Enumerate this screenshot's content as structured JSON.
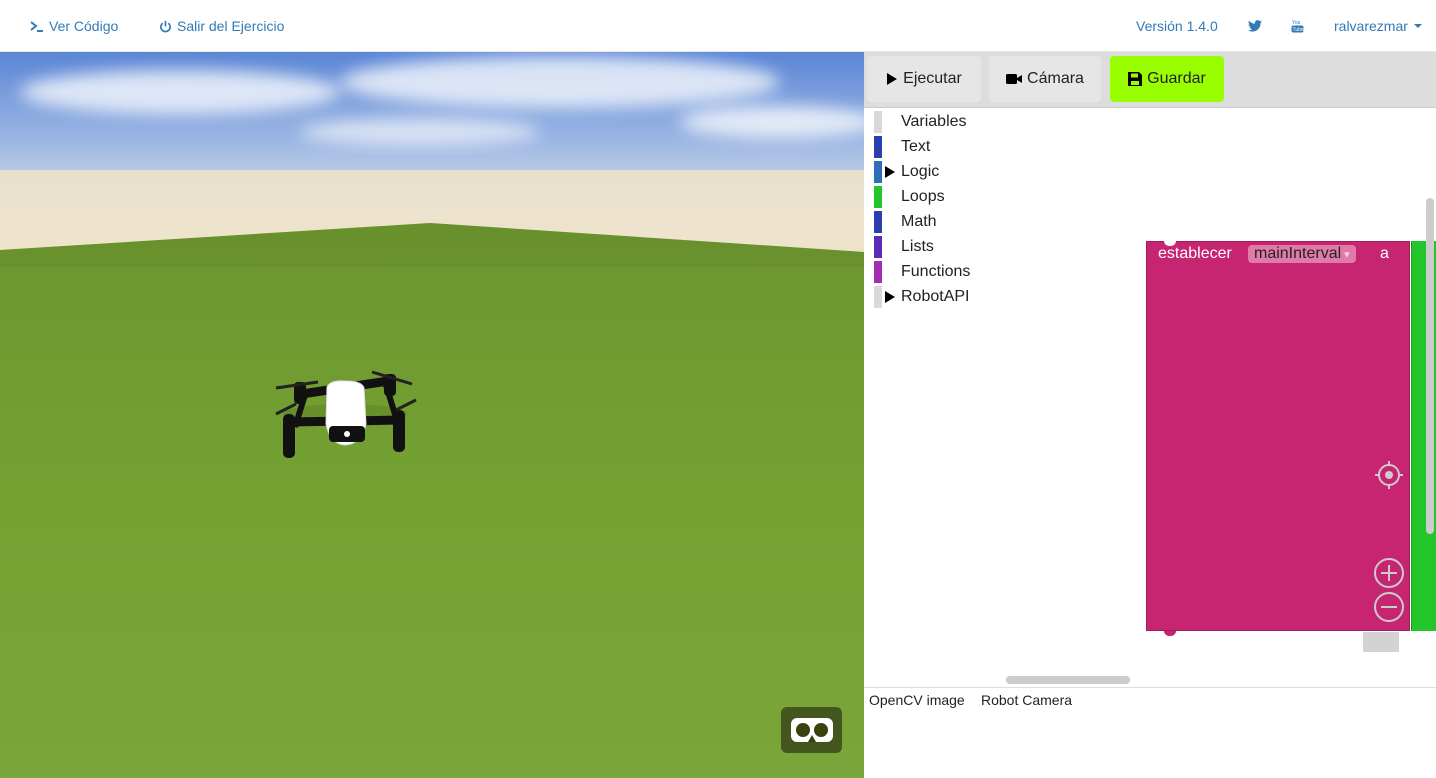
{
  "navbar": {
    "view_code": "Ver Código",
    "exit_exercise": "Salir del Ejercicio",
    "version": "Versión 1.4.0",
    "user": "ralvarezmar"
  },
  "toolbar": {
    "run": "Ejecutar",
    "camera": "Cámara",
    "save": "Guardar"
  },
  "toolbox": {
    "categories": [
      {
        "label": "Variables",
        "color": "#d9d9d9",
        "expandable": false
      },
      {
        "label": "Text",
        "color": "#2c3fae",
        "expandable": false
      },
      {
        "label": "Logic",
        "color": "#2c6fb5",
        "expandable": true
      },
      {
        "label": "Loops",
        "color": "#24c52a",
        "expandable": false
      },
      {
        "label": "Math",
        "color": "#2c3fae",
        "expandable": false
      },
      {
        "label": "Lists",
        "color": "#5b2cb5",
        "expandable": false
      },
      {
        "label": "Functions",
        "color": "#a42cb5",
        "expandable": false
      },
      {
        "label": "RobotAPI",
        "color": "#d9d9d9",
        "expandable": true
      }
    ]
  },
  "block": {
    "prefix": "establecer",
    "variable": "mainInterval",
    "dropdown": "▾",
    "suffix": "a",
    "color": "#c72472",
    "next_block_color": "#24c52a"
  },
  "bottom_tabs": {
    "opencv": "OpenCV image",
    "robot_camera": "Robot Camera"
  },
  "colors": {
    "link": "#337ab7",
    "save_button": "#99ff00"
  }
}
